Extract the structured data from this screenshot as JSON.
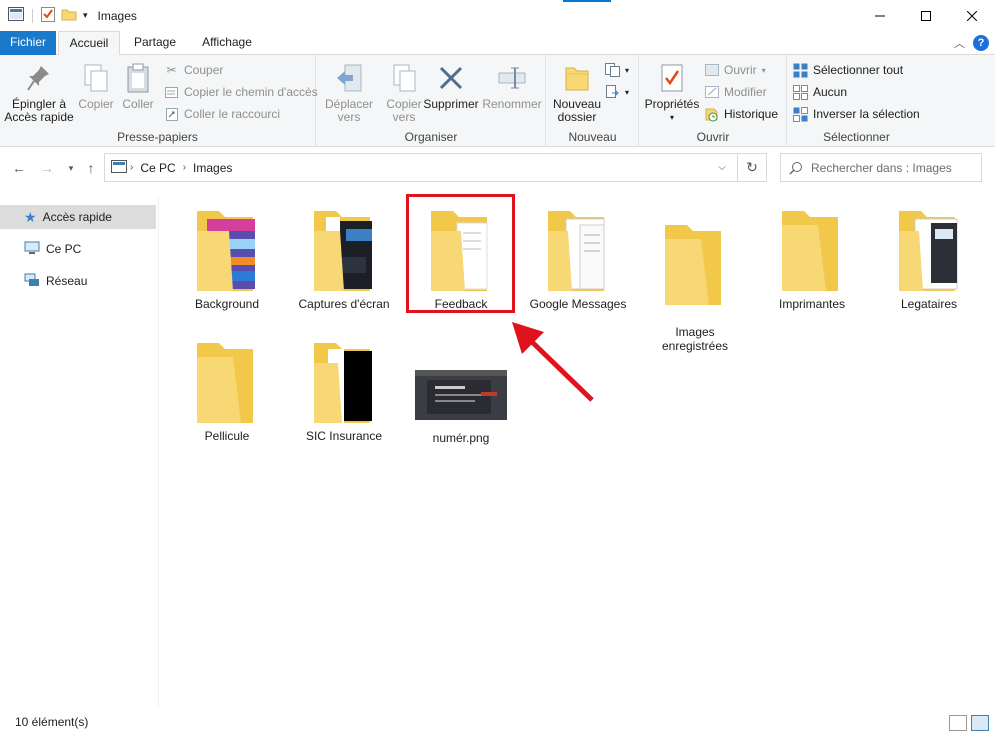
{
  "window": {
    "title": "Images"
  },
  "tabs": {
    "file": "Fichier",
    "home": "Accueil",
    "share": "Partage",
    "view": "Affichage"
  },
  "ribbon": {
    "clipboard": {
      "label": "Presse-papiers",
      "pin": [
        "Épingler à",
        "Accès rapide"
      ],
      "copy": "Copier",
      "paste": "Coller",
      "cut": "Couper",
      "copy_path": "Copier le chemin d'accès",
      "paste_shortcut": "Coller le raccourci"
    },
    "organize": {
      "label": "Organiser",
      "move_to": [
        "Déplacer",
        "vers"
      ],
      "copy_to": [
        "Copier",
        "vers"
      ],
      "delete": "Supprimer",
      "rename": "Renommer"
    },
    "new": {
      "label": "Nouveau",
      "new_folder": [
        "Nouveau",
        "dossier"
      ]
    },
    "open": {
      "label": "Ouvrir",
      "properties": "Propriétés",
      "open": "Ouvrir",
      "edit": "Modifier",
      "history": "Historique"
    },
    "select": {
      "label": "Sélectionner",
      "select_all": "Sélectionner tout",
      "select_none": "Aucun",
      "invert": "Inverser la sélection"
    }
  },
  "address": {
    "crumbs": [
      "Ce PC",
      "Images"
    ]
  },
  "search": {
    "placeholder": "Rechercher dans : Images"
  },
  "nav": {
    "items": [
      "Accès rapide",
      "Ce PC",
      "Réseau"
    ]
  },
  "items": [
    {
      "name": "Background",
      "kind": "folder-images"
    },
    {
      "name": "Captures d'écran",
      "kind": "folder-dark"
    },
    {
      "name": "Feedback",
      "kind": "folder-doc"
    },
    {
      "name": "Google Messages",
      "kind": "folder-doc"
    },
    {
      "name": "Images\nenregistrées",
      "kind": "folder"
    },
    {
      "name": "Imprimantes",
      "kind": "folder"
    },
    {
      "name": "Legataires",
      "kind": "folder-screens"
    },
    {
      "name": "Pellicule",
      "kind": "folder"
    },
    {
      "name": "SIC Insurance",
      "kind": "folder-black"
    },
    {
      "name": "numér.png",
      "kind": "png"
    }
  ],
  "status": {
    "count": "10 élément(s)"
  },
  "colors": {
    "accent": "#1979ca",
    "highlight": "#e0121b",
    "folder": "#f8d775"
  }
}
